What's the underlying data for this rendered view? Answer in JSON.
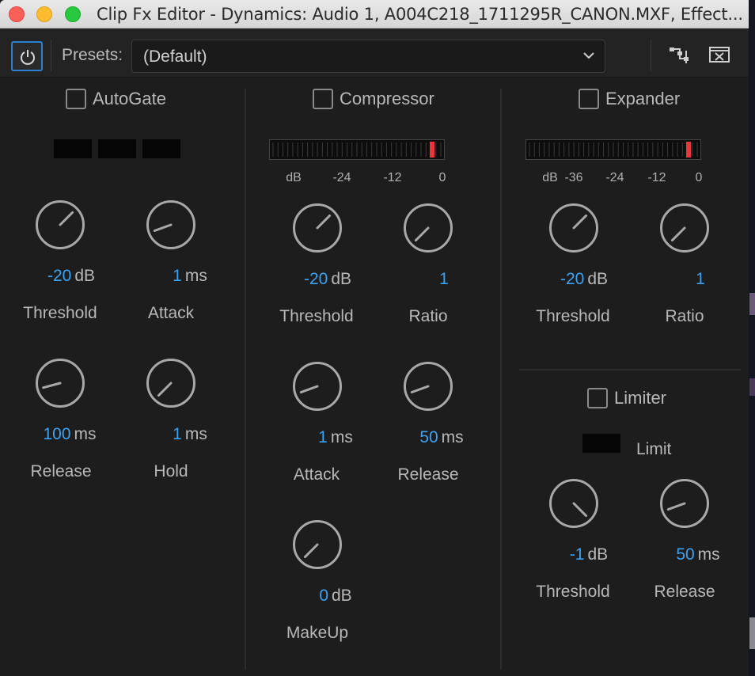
{
  "window": {
    "title": "Clip Fx Editor - Dynamics: Audio 1, A004C218_1711295R_CANON.MXF, Effect..."
  },
  "toolbar": {
    "presets_label": "Presets:",
    "presets_value": "(Default)",
    "power_icon": "power-icon",
    "routing_icon": "routing-icon",
    "clear_icon": "clear-icon"
  },
  "sections": {
    "autogate": {
      "title": "AutoGate",
      "knobs": [
        {
          "id": "threshold",
          "value": "-20",
          "unit": "dB",
          "label": "Threshold"
        },
        {
          "id": "attack",
          "value": "1",
          "unit": "ms",
          "label": "Attack"
        },
        {
          "id": "release",
          "value": "100",
          "unit": "ms",
          "label": "Release"
        },
        {
          "id": "hold",
          "value": "1",
          "unit": "ms",
          "label": "Hold"
        }
      ]
    },
    "compressor": {
      "title": "Compressor",
      "meter_scale": [
        "dB",
        "-24",
        "-12",
        "0"
      ],
      "knobs": [
        {
          "id": "threshold",
          "value": "-20",
          "unit": "dB",
          "label": "Threshold"
        },
        {
          "id": "ratio",
          "value": "1",
          "unit": "",
          "label": "Ratio"
        },
        {
          "id": "attack",
          "value": "1",
          "unit": "ms",
          "label": "Attack"
        },
        {
          "id": "release",
          "value": "50",
          "unit": "ms",
          "label": "Release"
        },
        {
          "id": "makeup",
          "value": "0",
          "unit": "dB",
          "label": "MakeUp"
        }
      ]
    },
    "expander": {
      "title": "Expander",
      "meter_scale": [
        "dB",
        "-36",
        "-24",
        "-12",
        "0"
      ],
      "knobs": [
        {
          "id": "threshold",
          "value": "-20",
          "unit": "dB",
          "label": "Threshold"
        },
        {
          "id": "ratio",
          "value": "1",
          "unit": "",
          "label": "Ratio"
        }
      ]
    },
    "limiter": {
      "title": "Limiter",
      "limit_label": "Limit",
      "knobs": [
        {
          "id": "threshold",
          "value": "-1",
          "unit": "dB",
          "label": "Threshold"
        },
        {
          "id": "release",
          "value": "50",
          "unit": "ms",
          "label": "Release"
        }
      ]
    }
  },
  "colors": {
    "value_blue": "#3da2f2",
    "meter_peak_red": "#e8373a",
    "power_ring_blue": "#2f7fd0"
  }
}
